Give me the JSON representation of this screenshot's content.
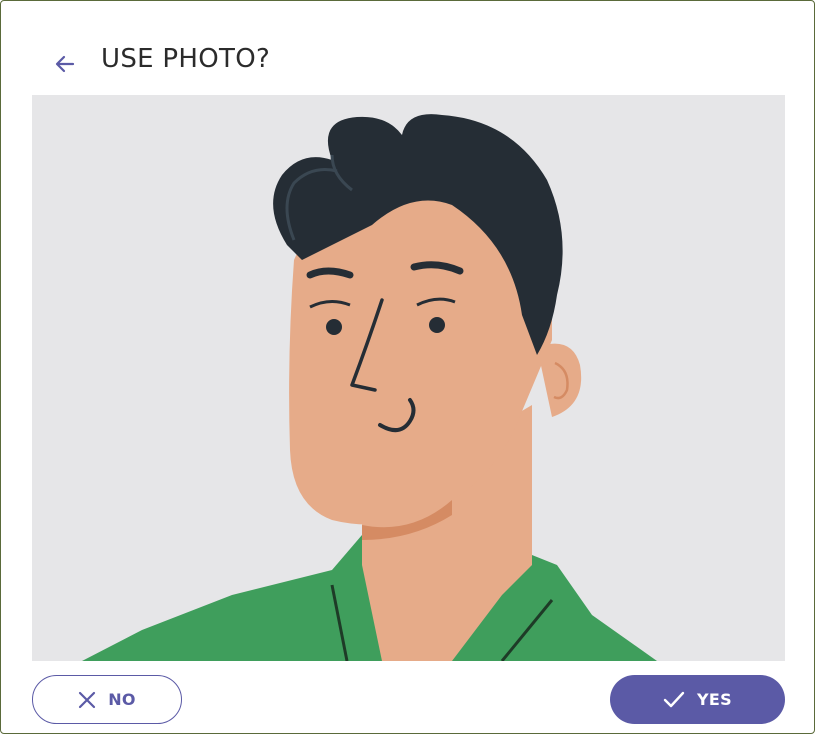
{
  "dialog": {
    "title": "USE PHOTO?",
    "back_icon": "arrow-left-icon",
    "photo_alt": "avatar-illustration"
  },
  "actions": {
    "no_label": "NO",
    "no_icon": "close-icon",
    "yes_label": "YES",
    "yes_icon": "check-icon"
  },
  "colors": {
    "accent": "#5b5aa6",
    "photo_background": "#e6e6e8",
    "hair": "#252d35",
    "skin": "#e6ab89",
    "shirt": "#3f9e5c"
  }
}
